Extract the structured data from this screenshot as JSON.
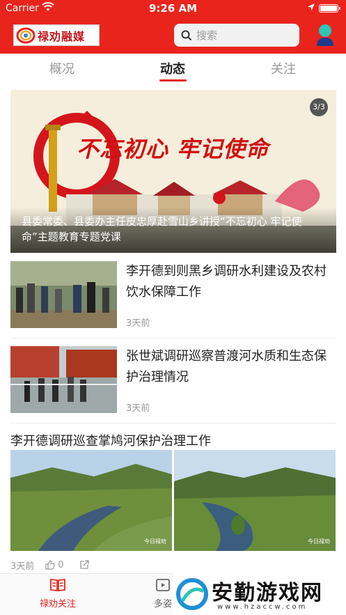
{
  "status_bar": {
    "carrier": "Carrier",
    "time": "9:26 AM"
  },
  "header": {
    "logo_text": "禄劝融媒",
    "search_placeholder": "搜索"
  },
  "tabs": [
    {
      "label": "概况"
    },
    {
      "label": "动态",
      "active": true
    },
    {
      "label": "关注"
    }
  ],
  "banner": {
    "page_indicator": "3/3",
    "slogan": "不忘初心 牢记使命",
    "caption": "县委常委、县委办主任皮忠厚赴雪山乡讲授“不忘初心 牢记使命”主题教育专题党课"
  },
  "news": [
    {
      "title": "李开德到则黑乡调研水利建设及农村饮水保障工作",
      "time": "3天前"
    },
    {
      "title": "张世斌调研巡察普渡河水质和生态保护治理情况",
      "time": "3天前"
    }
  ],
  "multi_news": {
    "title": "李开德调研巡查掌鸠河保护治理工作",
    "watermark": "今日禄劝",
    "time": "3天前",
    "likes": "0"
  },
  "bottom_nav": [
    {
      "label": "禄劝关注",
      "active": true
    },
    {
      "label": "多姿"
    }
  ],
  "site_watermark": {
    "text": "安勤游戏网",
    "url": "www.hzaccw.com"
  },
  "colors": {
    "brand_red": "#e9241d",
    "text_dark": "#222222",
    "text_muted": "#999999"
  }
}
